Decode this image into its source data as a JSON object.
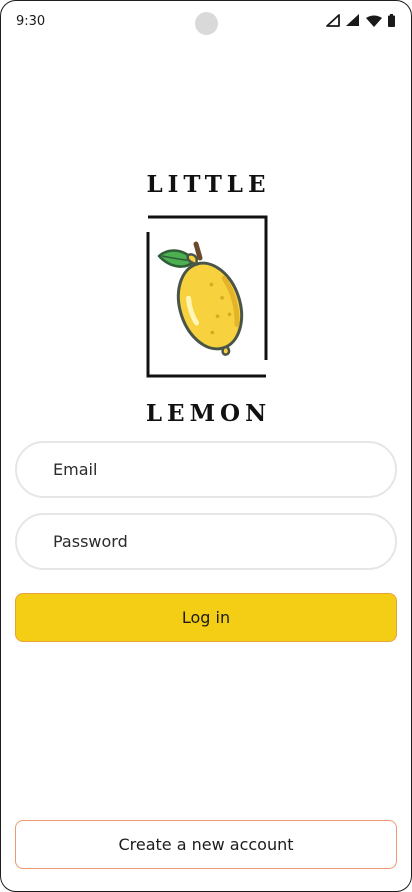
{
  "status_bar": {
    "time": "9:30",
    "icons": [
      "signal-outline-icon",
      "signal-icon",
      "wifi-icon",
      "battery-icon"
    ]
  },
  "logo": {
    "line1": "LITTLE",
    "line2": "LEMON",
    "image": "lemon-icon"
  },
  "form": {
    "email_placeholder": "Email",
    "email_value": "",
    "password_placeholder": "Password",
    "password_value": ""
  },
  "actions": {
    "login_label": "Log in",
    "create_account_label": "Create a new account"
  },
  "colors": {
    "primary_yellow": "#F4CE14",
    "login_border": "#E9A23A",
    "create_border": "#EE9972",
    "field_border": "#E6E6E6",
    "lemon_leaf": "#4CAF50",
    "lemon_fill": "#F7D23E"
  }
}
